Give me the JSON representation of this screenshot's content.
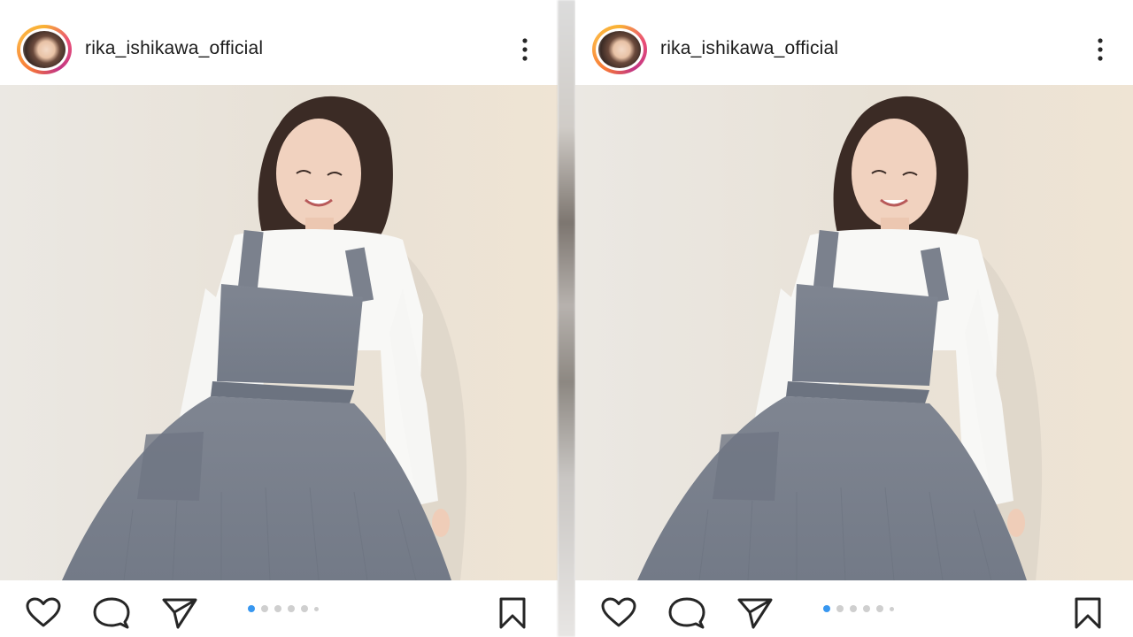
{
  "posts": [
    {
      "username": "rika_ishikawa_official",
      "icons": {
        "avatar": "profile-avatar",
        "more": "more-options-icon",
        "like": "heart-icon",
        "comment": "comment-icon",
        "share": "send-icon",
        "save": "bookmark-icon"
      },
      "carousel": {
        "total": 6,
        "active_index": 0
      },
      "colors": {
        "active_dot": "#3897f0",
        "ring_start": "#f9b233",
        "ring_end": "#c13584"
      }
    },
    {
      "username": "rika_ishikawa_official",
      "icons": {
        "avatar": "profile-avatar",
        "more": "more-options-icon",
        "like": "heart-icon",
        "comment": "comment-icon",
        "share": "send-icon",
        "save": "bookmark-icon"
      },
      "carousel": {
        "total": 6,
        "active_index": 0
      },
      "colors": {
        "active_dot": "#3897f0",
        "ring_start": "#f9b233",
        "ring_end": "#c13584"
      }
    }
  ]
}
